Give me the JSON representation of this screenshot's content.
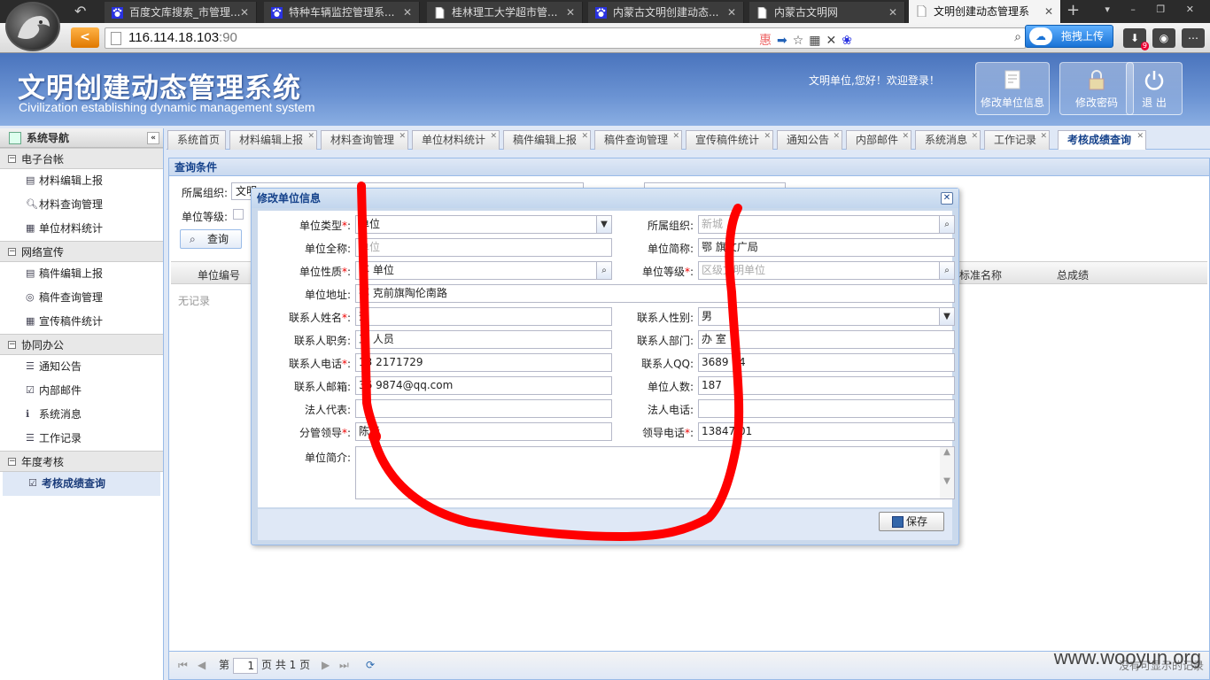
{
  "browser": {
    "tabs": [
      {
        "label": "百度文库搜索_市管理...",
        "icon": "baidu-paw-icon"
      },
      {
        "label": "特种车辆监控管理系...",
        "icon": "baidu-paw-icon"
      },
      {
        "label": "桂林理工大学超市管...",
        "icon": "page-icon"
      },
      {
        "label": "内蒙古文明创建动态...",
        "icon": "baidu-paw-icon"
      },
      {
        "label": "内蒙古文明网",
        "icon": "page-icon"
      },
      {
        "label": "文明创建动态管理系",
        "icon": "page-icon",
        "active": true
      }
    ],
    "url_host": "116.114.18.103",
    "url_port": ":90",
    "upload_label": "拖拽上传",
    "download_badge": "9"
  },
  "header": {
    "title": "文明创建动态管理系统",
    "subtitle": "Civilization establishing dynamic management system",
    "welcome": "文明单位,您好！欢迎登录！",
    "buttons": [
      "修改单位信息",
      "修改密码",
      "退 出"
    ]
  },
  "sidebar": {
    "title": "系统导航",
    "groups": [
      {
        "label": "电子台帐",
        "items": [
          "材料编辑上报",
          "材料查询管理",
          "单位材料统计"
        ]
      },
      {
        "label": "网络宣传",
        "items": [
          "稿件编辑上报",
          "稿件查询管理",
          "宣传稿件统计"
        ]
      },
      {
        "label": "协同办公",
        "items": [
          "通知公告",
          "内部邮件",
          "系统消息",
          "工作记录"
        ]
      },
      {
        "label": "年度考核",
        "items": [
          "考核成绩查询"
        ]
      }
    ]
  },
  "main_tabs": [
    "系统首页",
    "材料编辑上报",
    "材料查询管理",
    "单位材料统计",
    "稿件编辑上报",
    "稿件查询管理",
    "宣传稿件统计",
    "通知公告",
    "内部邮件",
    "系统消息",
    "工作记录",
    "考核成绩查询"
  ],
  "query": {
    "header": "查询条件",
    "org_label": "所属组织:",
    "org_value": "文明",
    "level_label": "单位等级:",
    "search_btn": "查询",
    "grid_cols": [
      "单位编号",
      "标准名称",
      "总成绩"
    ],
    "no_records": "无记录",
    "pager_page": "第",
    "pager_value": "1",
    "pager_total": "页 共 1 页",
    "no_more": "没有可显示的记录",
    "watermark": "www.wooyun.org"
  },
  "modal": {
    "title": "修改单位信息",
    "fields": {
      "unit_type": {
        "label": "单位类型",
        "value": "单位"
      },
      "org": {
        "label": "所属组织:",
        "value": "新城"
      },
      "fullname": {
        "label": "单位全称:",
        "value": "单位"
      },
      "shortname": {
        "label": "单位简称:",
        "value": "鄂 旗文广局"
      },
      "nature": {
        "label": "单位性质",
        "value": "事 单位"
      },
      "level": {
        "label": "单位等级",
        "value": "区级文明单位"
      },
      "address": {
        "label": "单位地址:",
        "value": "鄂 克前旗陶伦南路"
      },
      "contact_name": {
        "label": "联系人姓名",
        "value": "查"
      },
      "contact_gender": {
        "label": "联系人性别:",
        "value": "男"
      },
      "contact_title": {
        "label": "联系人职务:",
        "value": "工 人员"
      },
      "contact_dept": {
        "label": "联系人部门:",
        "value": "办 室"
      },
      "contact_phone": {
        "label": "联系人电话",
        "value": "13 2171729"
      },
      "contact_qq": {
        "label": "联系人QQ:",
        "value": "3689 74"
      },
      "contact_email": {
        "label": "联系人邮箱:",
        "value": "36 9874@qq.com"
      },
      "headcount": {
        "label": "单位人数:",
        "value": "187"
      },
      "legal_rep": {
        "label": "法人代表:",
        "value": ""
      },
      "legal_phone": {
        "label": "法人电话:",
        "value": ""
      },
      "leader": {
        "label": "分管领导",
        "value": "陈春"
      },
      "leader_phone": {
        "label": "领导电话",
        "value": "13847 01"
      },
      "intro": {
        "label": "单位简介:",
        "value": ""
      }
    },
    "save_label": "保存"
  }
}
